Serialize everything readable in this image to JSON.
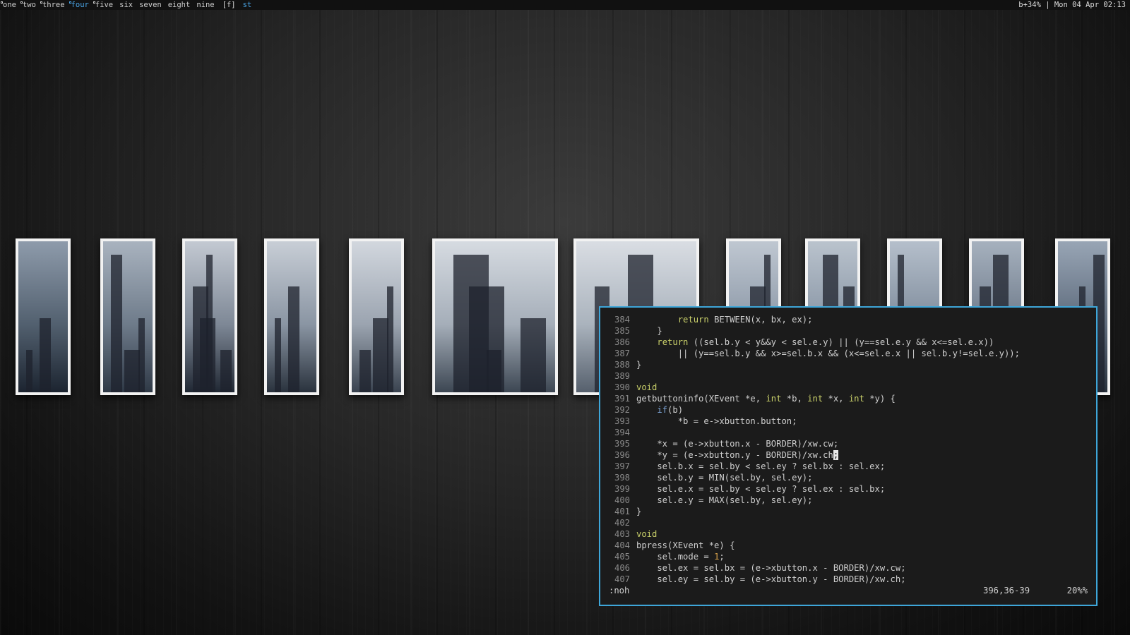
{
  "bar": {
    "tags": [
      {
        "label": "one",
        "occupied": true,
        "active": false
      },
      {
        "label": "two",
        "occupied": true,
        "active": false
      },
      {
        "label": "three",
        "occupied": true,
        "active": false
      },
      {
        "label": "four",
        "occupied": true,
        "active": true
      },
      {
        "label": "five",
        "occupied": true,
        "active": false
      },
      {
        "label": "six",
        "occupied": false,
        "active": false
      },
      {
        "label": "seven",
        "occupied": false,
        "active": false
      },
      {
        "label": "eight",
        "occupied": false,
        "active": false
      },
      {
        "label": "nine",
        "occupied": false,
        "active": false
      }
    ],
    "layout": "[f]",
    "window_title": "st",
    "status": "b+34% | Mon 04 Apr 02:13",
    "accent": "#4aa6e8"
  },
  "editor": {
    "lines": [
      {
        "n": "384",
        "t": "        <kw>return</kw> BETWEEN(x, bx, ex);"
      },
      {
        "n": "385",
        "t": "    }"
      },
      {
        "n": "386",
        "t": "    <kw>return</kw> ((sel.b.y < y&&y < sel.e.y) || (y==sel.e.y && x<=sel.e.x))"
      },
      {
        "n": "387",
        "t": "        || (y==sel.b.y && x>=sel.b.x && (x<=sel.e.x || sel.b.y!=sel.e.y));"
      },
      {
        "n": "388",
        "t": "}"
      },
      {
        "n": "389",
        "t": ""
      },
      {
        "n": "390",
        "t": "<kw>void</kw>"
      },
      {
        "n": "391",
        "t": "getbuttoninfo(XEvent *e, <kw>int</kw> *b, <kw>int</kw> *x, <kw>int</kw> *y) {"
      },
      {
        "n": "392",
        "t": "    <fl>if</fl>(b)"
      },
      {
        "n": "393",
        "t": "        *b = e->xbutton.button;"
      },
      {
        "n": "394",
        "t": ""
      },
      {
        "n": "395",
        "t": "    *x = (e->xbutton.x - BORDER)/xw.cw;"
      },
      {
        "n": "396",
        "t": "    *y = (e->xbutton.y - BORDER)/xw.ch<cur>;</cur>"
      },
      {
        "n": "397",
        "t": "    sel.b.x = sel.by < sel.ey ? sel.bx : sel.ex;"
      },
      {
        "n": "398",
        "t": "    sel.b.y = MIN(sel.by, sel.ey);"
      },
      {
        "n": "399",
        "t": "    sel.e.x = sel.by < sel.ey ? sel.ex : sel.bx;"
      },
      {
        "n": "400",
        "t": "    sel.e.y = MAX(sel.by, sel.ey);"
      },
      {
        "n": "401",
        "t": "}"
      },
      {
        "n": "402",
        "t": ""
      },
      {
        "n": "403",
        "t": "<kw>void</kw>"
      },
      {
        "n": "404",
        "t": "bpress(XEvent *e) {"
      },
      {
        "n": "405",
        "t": "    sel.mode = <nm>1</nm>;"
      },
      {
        "n": "406",
        "t": "    sel.ex = sel.bx = (e->xbutton.x - BORDER)/xw.cw;"
      },
      {
        "n": "407",
        "t": "    sel.ey = sel.by = (e->xbutton.y - BORDER)/xw.ch;"
      }
    ],
    "command": ":noh",
    "position": "396,36-39",
    "percent": "20%%",
    "border_color": "#3ea6d9"
  },
  "photos": [
    {
      "theme": "cityscape-night"
    },
    {
      "theme": "foggy-hills"
    },
    {
      "theme": "tower-blocks"
    },
    {
      "theme": "skyscraper-smoke"
    },
    {
      "theme": "spire-haze"
    },
    {
      "theme": "station-tower"
    },
    {
      "theme": "ring-station"
    },
    {
      "theme": "ship-hull"
    },
    {
      "theme": "ship-hull-2"
    },
    {
      "theme": "debris-sky"
    },
    {
      "theme": "tall-tower"
    },
    {
      "theme": "night-sky"
    }
  ]
}
